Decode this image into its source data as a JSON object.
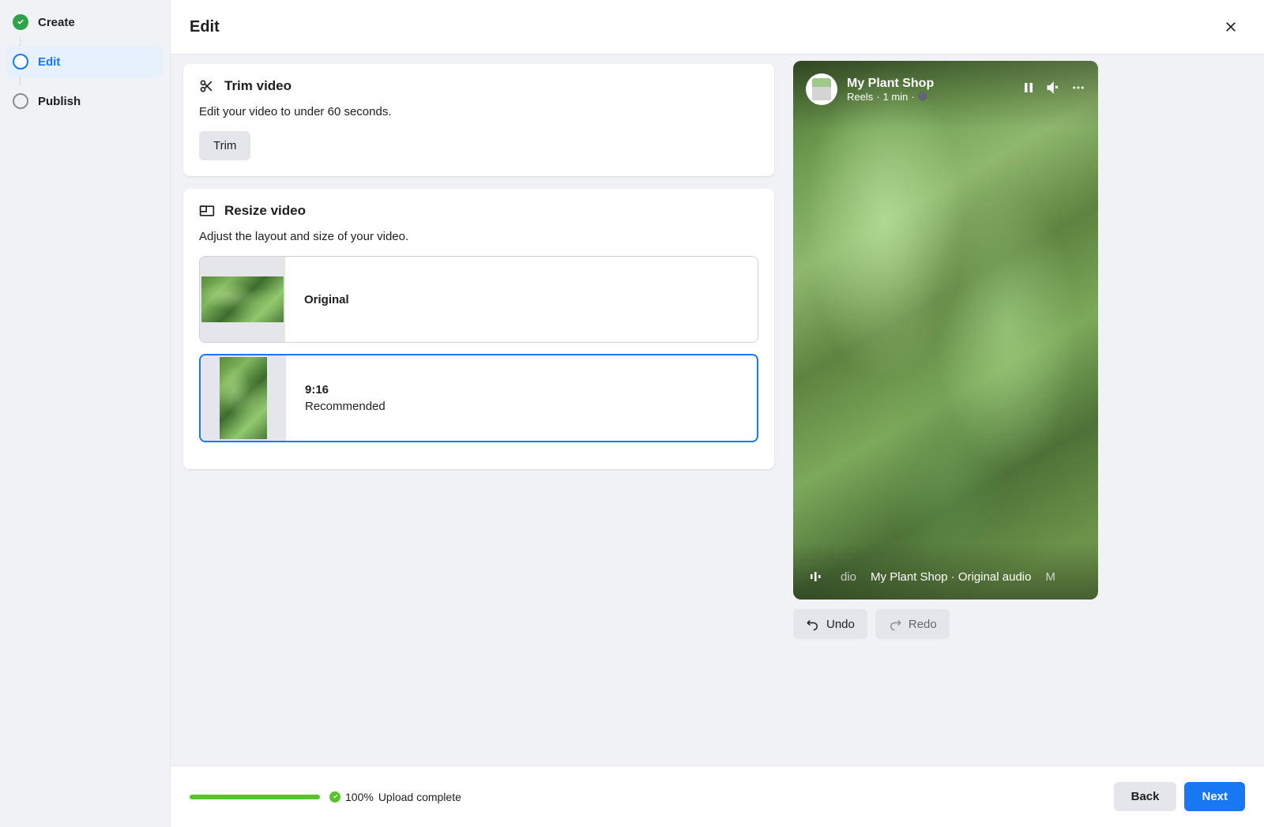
{
  "sidebar": {
    "steps": [
      {
        "label": "Create",
        "state": "done"
      },
      {
        "label": "Edit",
        "state": "current"
      },
      {
        "label": "Publish",
        "state": "pending"
      }
    ]
  },
  "header": {
    "title": "Edit"
  },
  "trim": {
    "title": "Trim video",
    "desc": "Edit your video to under 60 seconds.",
    "button": "Trim"
  },
  "resize": {
    "title": "Resize video",
    "desc": "Adjust the layout and size of your video.",
    "options": [
      {
        "label": "Original",
        "sub": ""
      },
      {
        "label": "9:16",
        "sub": "Recommended"
      }
    ]
  },
  "preview": {
    "page_name": "My Plant Shop",
    "meta_type": "Reels",
    "meta_time": "1 min",
    "audio_text_left": "dio",
    "audio_text": "My Plant Shop · Original audio",
    "audio_text_right": "M"
  },
  "actions": {
    "undo": "Undo",
    "redo": "Redo"
  },
  "footer": {
    "upload_percent": "100%",
    "upload_status": "Upload complete",
    "back": "Back",
    "next": "Next"
  }
}
